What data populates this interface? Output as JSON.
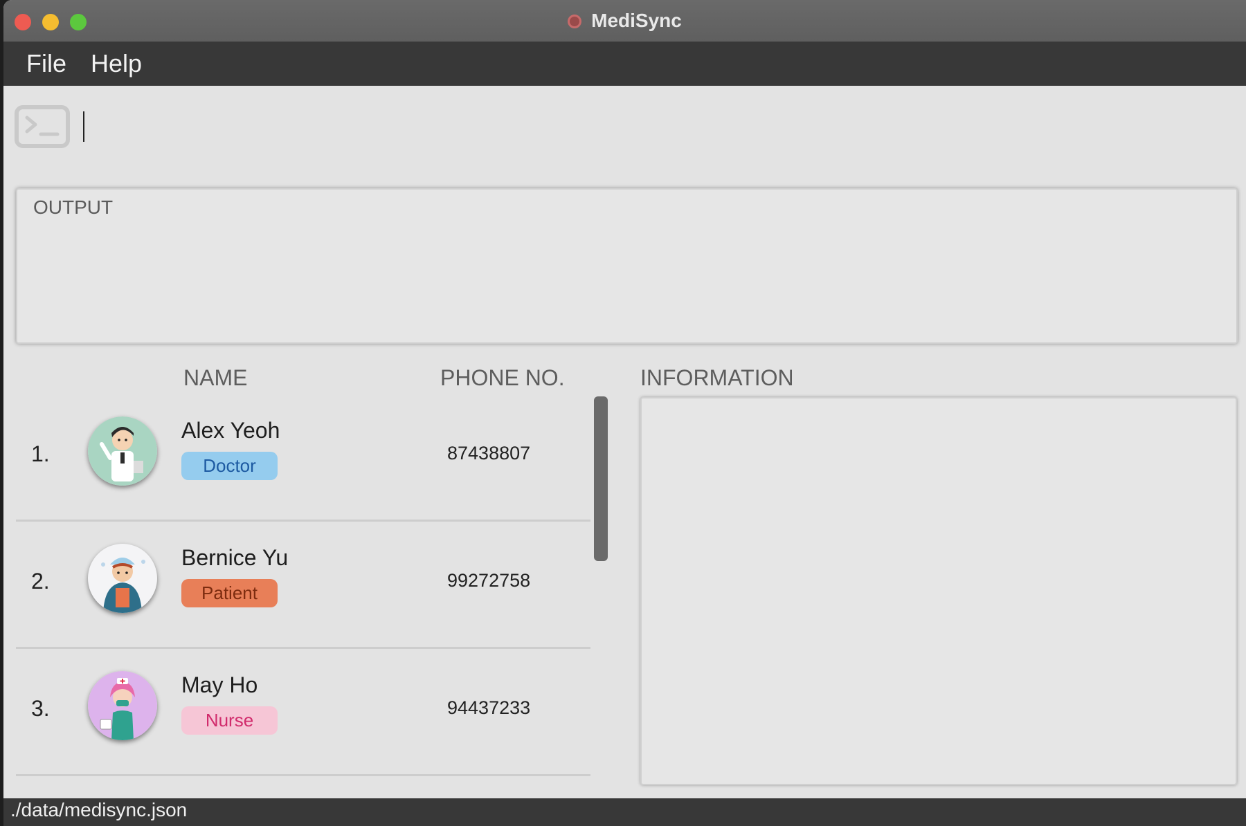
{
  "window": {
    "title": "MediSync"
  },
  "menu": {
    "file": "File",
    "help": "Help"
  },
  "command": {
    "value": ""
  },
  "output": {
    "label": "OUTPUT",
    "text": ""
  },
  "table": {
    "name_header": "NAME",
    "phone_header": "PHONE NO."
  },
  "info": {
    "label": "INFORMATION"
  },
  "persons": [
    {
      "index": "1.",
      "name": "Alex Yeoh",
      "role": "Doctor",
      "phone": "87438807",
      "avatar": "doctor-avatar"
    },
    {
      "index": "2.",
      "name": "Bernice Yu",
      "role": "Patient",
      "phone": "99272758",
      "avatar": "patient-avatar"
    },
    {
      "index": "3.",
      "name": "May Ho",
      "role": "Nurse",
      "phone": "94437233",
      "avatar": "nurse-avatar"
    }
  ],
  "status": {
    "path": "./data/medisync.json"
  },
  "colors": {
    "doctor_badge": "#95ccee",
    "patient_badge": "#e87f58",
    "nurse_badge": "#f6c6d6",
    "bar_dark": "#383838"
  }
}
